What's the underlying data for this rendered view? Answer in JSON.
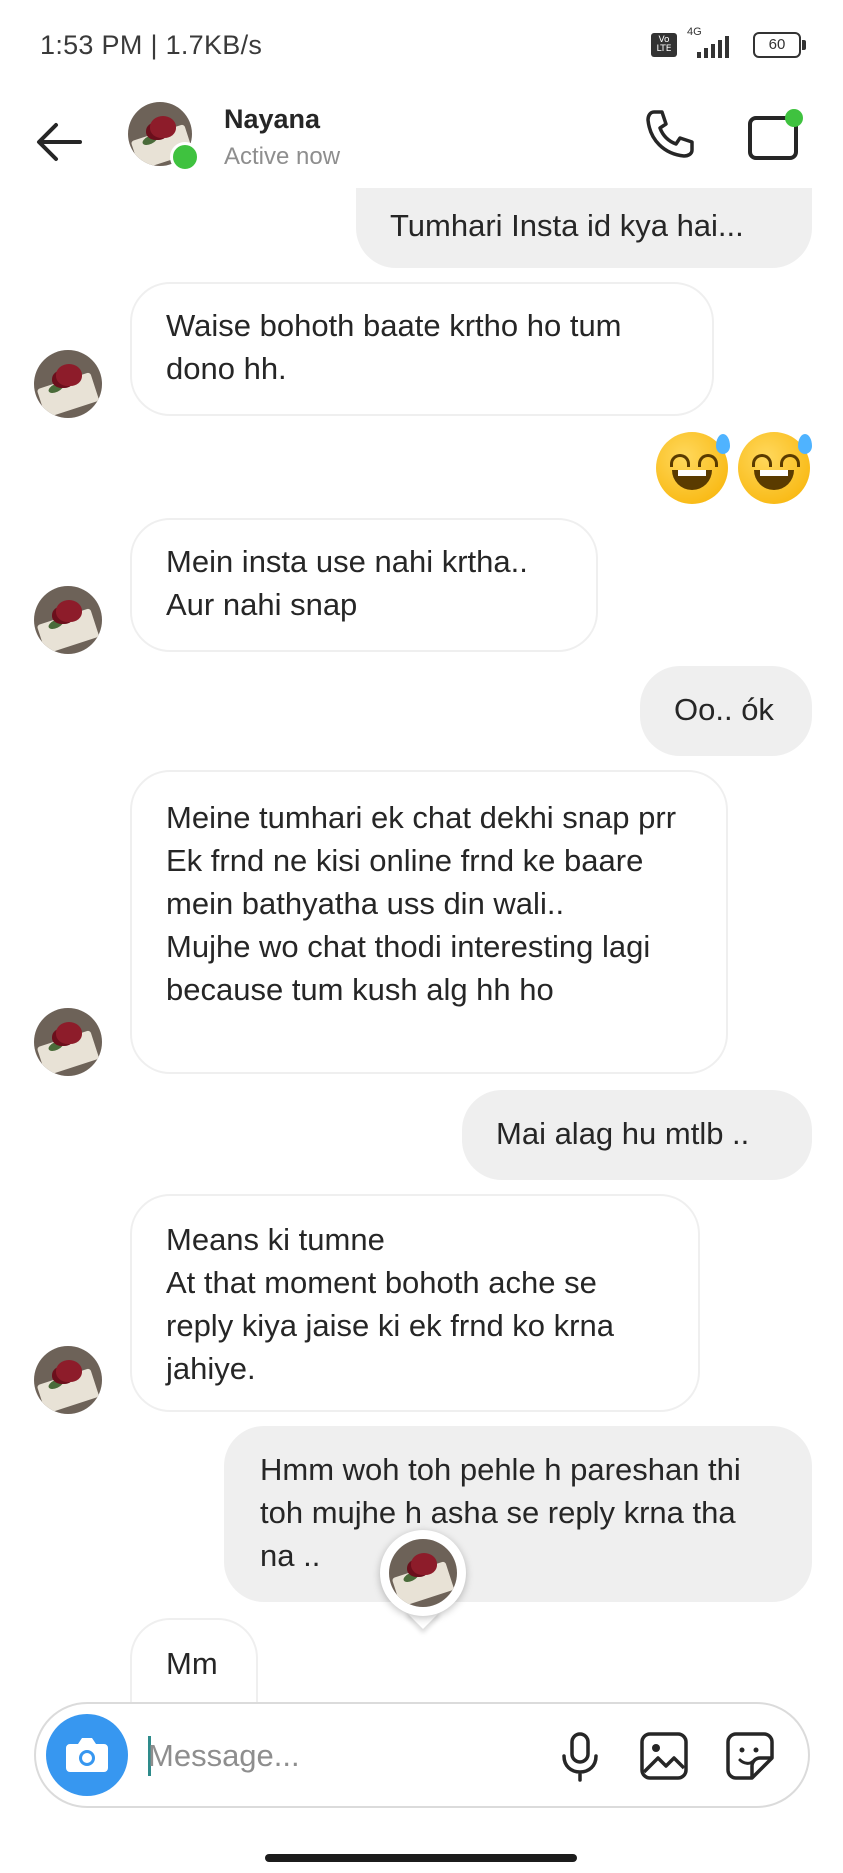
{
  "status_bar": {
    "time_speed": "1:53 PM | 1.7KB/s",
    "volte_label": "Vo LTE",
    "network_label": "4G",
    "battery": "60"
  },
  "header": {
    "name": "Nayana",
    "status": "Active now",
    "icons": [
      "back-arrow-icon",
      "phone-icon",
      "video-call-icon"
    ],
    "online_color": "#3fc23f"
  },
  "messages": [
    {
      "side": "out",
      "text": "Tumhari Insta id kya hai..."
    },
    {
      "side": "in",
      "text": "Waise bohoth baate krtho ho tum dono hh."
    },
    {
      "side": "out",
      "emoji": [
        "😅",
        "😅"
      ]
    },
    {
      "side": "in",
      "text": "Mein insta use nahi krtha..\nAur nahi snap"
    },
    {
      "side": "out",
      "text": "Oo.. ók"
    },
    {
      "side": "in",
      "text": "Meine tumhari ek chat dekhi snap prr\nEk frnd ne kisi online frnd ke baare mein bathyatha uss din wali..\nMujhe wo chat thodi interesting lagi because tum kush alg hh ho"
    },
    {
      "side": "out",
      "text": "Mai alag hu mtlb .."
    },
    {
      "side": "in",
      "text": "Means ki tumne\nAt that moment bohoth ache se reply kiya jaise ki ek frnd ko krna jahiye."
    },
    {
      "side": "out",
      "text": "Hmm woh toh pehle h pareshan thi toh mujhe h asha se reply krna tha na .."
    },
    {
      "side": "in",
      "text": "Mm"
    }
  ],
  "composer": {
    "placeholder": "Message...",
    "icons": [
      "camera-icon",
      "microphone-icon",
      "gallery-icon",
      "sticker-icon"
    ],
    "camera_color": "#3797f0"
  }
}
